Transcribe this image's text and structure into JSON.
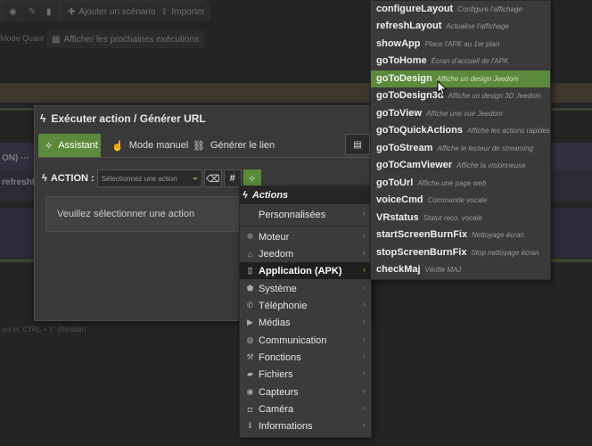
{
  "background": {
    "toolbar_items": [
      "Ajouter un scénario",
      "Importer"
    ],
    "mode_label": "Mode Quant",
    "next_exec_label": "Afficher les prochaines exécutions",
    "left_fragments": [
      "ON) ···",
      "refreshLa"
    ],
    "footer_hint": "act et 'CTRL + Y' (Rétablir)"
  },
  "modal": {
    "title": "Exécuter action / Générer URL",
    "tabs": [
      {
        "label": "Assistant",
        "icon": "magic-wand-icon"
      },
      {
        "label": "Mode manuel",
        "icon": "hand-pointer-icon"
      },
      {
        "label": "Générer le lien",
        "icon": "link-icon"
      }
    ],
    "action_label": "ACTION :",
    "select_placeholder": "Sélectionnez une action",
    "info_text": "Veuillez sélectionner une action"
  },
  "menu_actions": {
    "header": "Actions",
    "items": [
      {
        "label": "Personnalisées",
        "icon": "none"
      },
      {
        "label": "Moteur",
        "icon": "cog-icon"
      },
      {
        "label": "Jeedom",
        "icon": "jeedom-icon"
      },
      {
        "label": "Application (APK)",
        "icon": "mobile-icon",
        "selected": true
      },
      {
        "label": "Système",
        "icon": "android-icon"
      },
      {
        "label": "Téléphonie",
        "icon": "phone-icon"
      },
      {
        "label": "Médias",
        "icon": "play-icon"
      },
      {
        "label": "Communication",
        "icon": "globe-icon"
      },
      {
        "label": "Fonctions",
        "icon": "wrench-icon"
      },
      {
        "label": "Fichiers",
        "icon": "folder-icon"
      },
      {
        "label": "Capteurs",
        "icon": "eye-icon"
      },
      {
        "label": "Caméra",
        "icon": "camera-icon"
      },
      {
        "label": "Informations",
        "icon": "info-icon"
      }
    ]
  },
  "menu_apk": {
    "items": [
      {
        "name": "configureLayout",
        "desc": "Configure l'affichage"
      },
      {
        "name": "refreshLayout",
        "desc": "Actualise l'affichage"
      },
      {
        "name": "showApp",
        "desc": "Place l'APK au 1er plan"
      },
      {
        "name": "goToHome",
        "desc": "Écran d'accueil de l'APK"
      },
      {
        "name": "goToDesign",
        "desc": "Affiche un design Jeedom",
        "highlighted": true
      },
      {
        "name": "goToDesign3d",
        "desc": "Affiche un design 3D Jeedom"
      },
      {
        "name": "goToView",
        "desc": "Affiche une vue Jeedom"
      },
      {
        "name": "goToQuickActions",
        "desc": "Affiche les actions rapides"
      },
      {
        "name": "goToStream",
        "desc": "Affiche le lecteur de streaming"
      },
      {
        "name": "goToCamViewer",
        "desc": "Affiche la visionneuse"
      },
      {
        "name": "goToUrl",
        "desc": "Affiche une page web"
      },
      {
        "name": "voiceCmd",
        "desc": "Commande vocale"
      },
      {
        "name": "VRstatus",
        "desc": "Statut reco. vocale"
      },
      {
        "name": "startScreenBurnFix",
        "desc": "Nettoyage écran"
      },
      {
        "name": "stopScreenBurnFix",
        "desc": "Stop nettoyage écran"
      },
      {
        "name": "checkMaj",
        "desc": "Vérifie MAJ"
      }
    ]
  },
  "colors": {
    "accent": "#5b8a3a",
    "highlight": "#4e7f2e"
  }
}
